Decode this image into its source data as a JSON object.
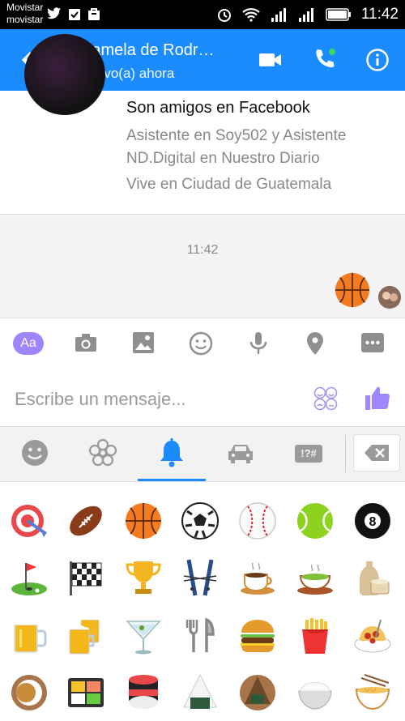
{
  "status_bar": {
    "carrier_top": "Movistar",
    "carrier_bottom": "movistar",
    "time": "11:42",
    "icons": [
      "twitter-icon",
      "clipboard-icon",
      "bag-icon",
      "alarm-icon",
      "wifi-icon",
      "signal-icon",
      "signal-icon",
      "battery-icon"
    ]
  },
  "header": {
    "contact_name": "Pamela de Rodr…",
    "contact_status": "Activo(a) ahora",
    "accent_color": "#1a8cff"
  },
  "profile_card": {
    "title": "Son amigos en Facebook",
    "line1": "Asistente en Soy502 y Asistente",
    "line2": "ND.Digital en Nuestro Diario",
    "line3": "Vive en Ciudad de Guatemala"
  },
  "conversation": {
    "timestamp": "11:42",
    "sent_emoji": "basketball"
  },
  "toolbar": {
    "aa_label": "Aa",
    "icons": [
      "camera-icon",
      "gallery-icon",
      "smiley-icon",
      "microphone-icon",
      "location-pin-icon",
      "more-icon"
    ]
  },
  "composer": {
    "placeholder": "Escribe un mensaje..."
  },
  "emoji_categories": {
    "items": [
      "smiley",
      "flower",
      "bell",
      "car",
      "symbols"
    ],
    "symbols_label": "!?#",
    "selected": "bell"
  },
  "emoji_grid": [
    [
      "dart",
      "football",
      "basketball",
      "soccer-ball",
      "baseball",
      "tennis-ball",
      "8-ball"
    ],
    [
      "golf",
      "checkered-flag",
      "trophy",
      "skis",
      "coffee",
      "tea",
      "sake"
    ],
    [
      "beer",
      "beers",
      "cocktail",
      "fork-knife",
      "hamburger",
      "fries",
      "spaghetti"
    ],
    [
      "curry",
      "bento",
      "sushi",
      "rice-ball",
      "onigiri",
      "rice-bowl",
      "ramen"
    ]
  ]
}
